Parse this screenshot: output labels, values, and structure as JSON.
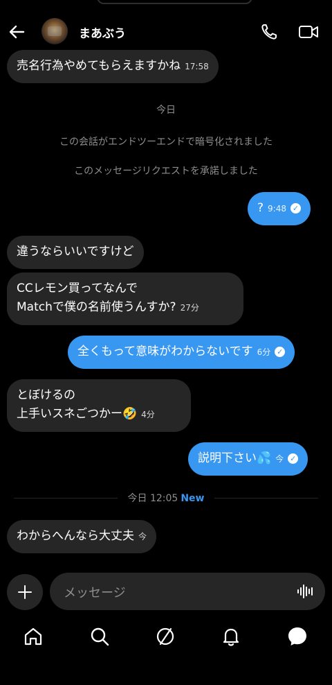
{
  "header": {
    "contact_name": "まあぶう"
  },
  "messages": [
    {
      "direction": "in",
      "text": "売名行為やめてもらえますかね",
      "time": "17:58"
    },
    {
      "direction": "system",
      "text": "今日"
    },
    {
      "direction": "system",
      "text": "この会話がエンドツーエンドで暗号化されました"
    },
    {
      "direction": "system",
      "text": "このメッセージリクエストを承諾しました"
    },
    {
      "direction": "out",
      "text": "?",
      "time": "9:48",
      "read": true
    },
    {
      "direction": "in",
      "text": "違うならいいですけど"
    },
    {
      "direction": "in",
      "lines": [
        "CCレモン買ってなんで",
        "Matchで僕の名前使うんすか?"
      ],
      "time": "27分"
    },
    {
      "direction": "out",
      "text": "全くもって意味がわからないです",
      "time": "6分",
      "read": true
    },
    {
      "direction": "in",
      "lines": [
        "とぼけるの",
        "上手いスネごつかー🤣"
      ],
      "time": "4分"
    },
    {
      "direction": "out",
      "text": "説明下さい💦",
      "time": "今",
      "read": true
    },
    {
      "direction": "in",
      "text": "わからへんなら大丈夫",
      "time": "今"
    }
  ],
  "new_divider": {
    "text": "今日 12:05",
    "label": "New"
  },
  "composer": {
    "placeholder": "メッセージ",
    "add_icon": "plus-icon",
    "voice_icon": "voice-wave-icon"
  },
  "nav": {
    "items": [
      "home-icon",
      "search-icon",
      "explore-icon",
      "notifications-icon",
      "messages-icon"
    ]
  },
  "colors": {
    "background": "#000000",
    "incoming_bubble": "#262626",
    "outgoing_bubble": "#3897f0",
    "muted_text": "#8e8e8e",
    "new_label": "#3897f0"
  }
}
